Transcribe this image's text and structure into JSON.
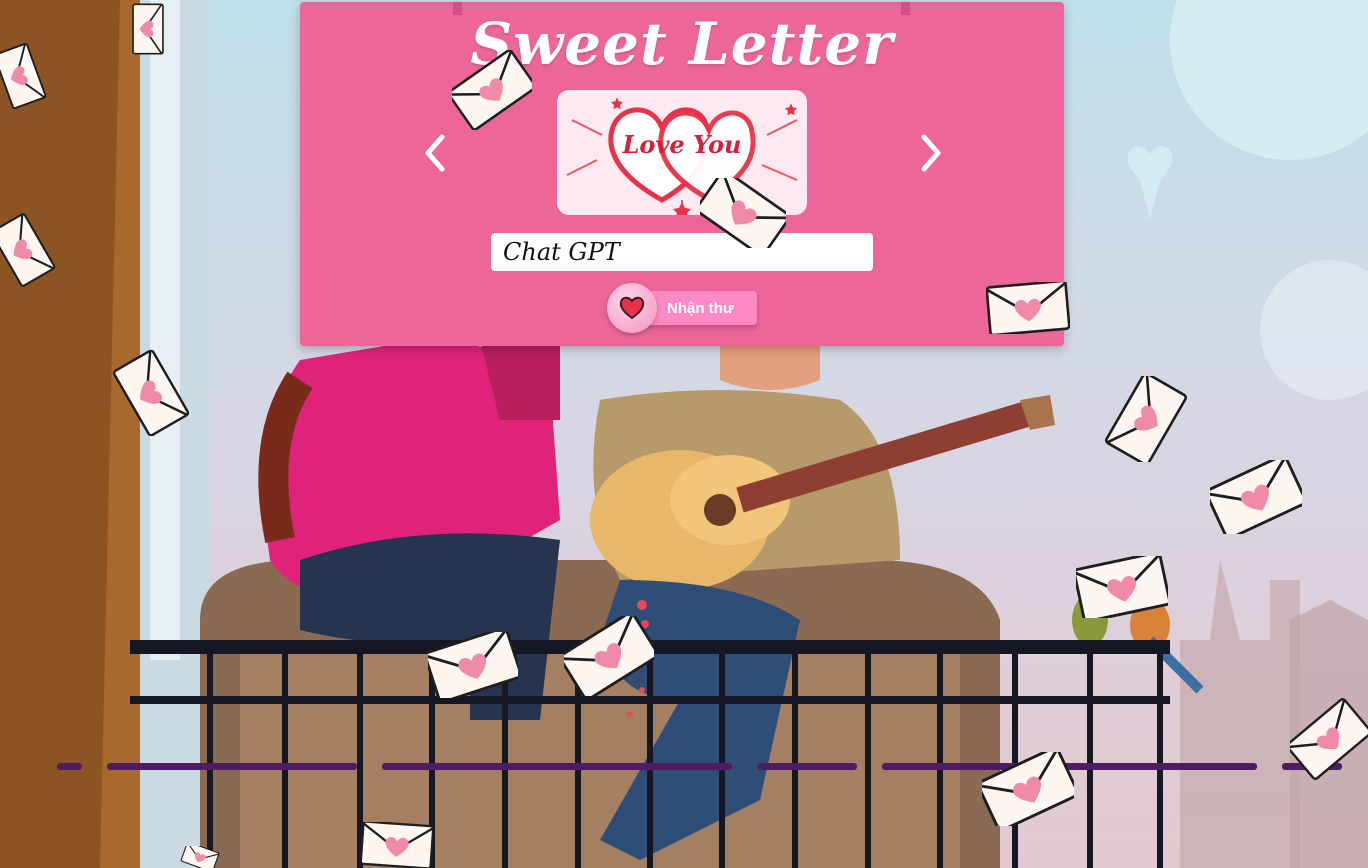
{
  "header": {
    "title": "Sweet Letter"
  },
  "carousel": {
    "image_text": "Love You",
    "prev_icon": "chevron-left-icon",
    "next_icon": "chevron-right-icon"
  },
  "form": {
    "name_value": "Chat GPT",
    "submit_label": "Nhận thư",
    "submit_icon": "heart-icon"
  },
  "colors": {
    "card": "#ec6699",
    "button": "#ff8ac3",
    "heart": "#e8324a",
    "envelope_heart": "#f08ba7"
  }
}
